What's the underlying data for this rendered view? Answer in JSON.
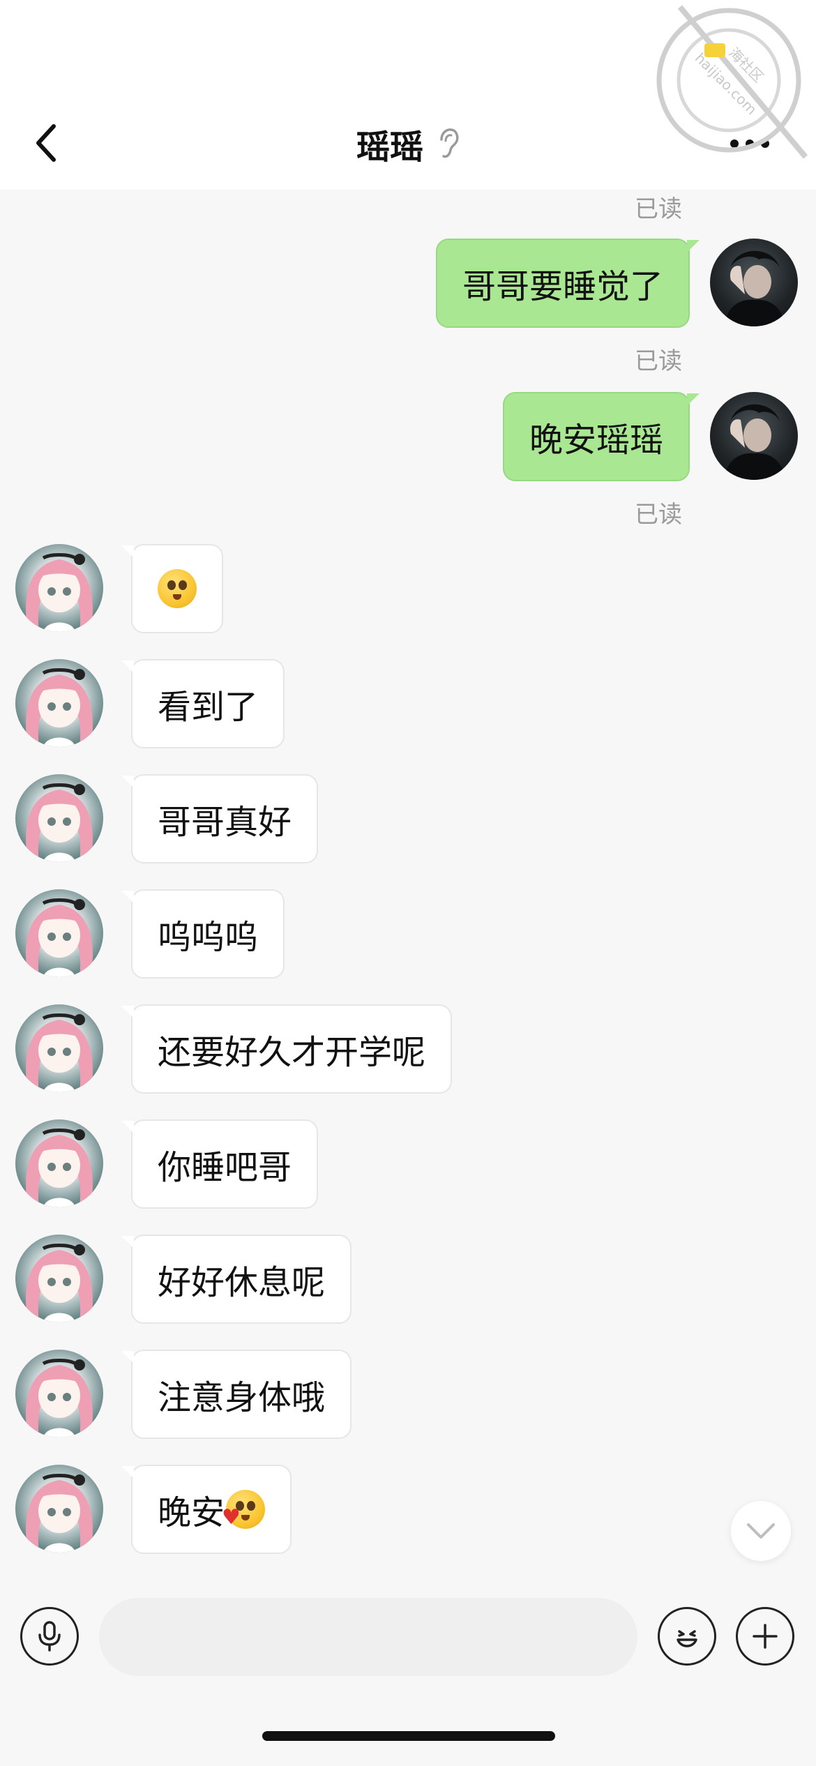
{
  "header": {
    "title": "瑶瑶",
    "back_icon": "chevron-left-icon",
    "ear_icon": "ear-icon",
    "more_icon": "more-dots-icon"
  },
  "watermark": {
    "text": "海社区",
    "url_text": "haijiao.com"
  },
  "status": {
    "read_label": "已读"
  },
  "messages_me": [
    {
      "text": "哥哥要睡觉了",
      "read": "已读"
    },
    {
      "text": "晚安瑶瑶",
      "read": "已读"
    }
  ],
  "messages_her": [
    {
      "text": "",
      "emoji": "blushing-face-emoji"
    },
    {
      "text": "看到了"
    },
    {
      "text": "哥哥真好"
    },
    {
      "text": "呜呜呜"
    },
    {
      "text": "还要好久才开学呢"
    },
    {
      "text": "你睡吧哥"
    },
    {
      "text": "好好休息呢"
    },
    {
      "text": "注意身体哦"
    },
    {
      "text": "晚安",
      "emoji": "hugging-heart-emoji"
    }
  ],
  "input": {
    "value": "",
    "placeholder": ""
  },
  "colors": {
    "my_bubble": "#a9e793",
    "her_bubble": "#ffffff",
    "background": "#f7f7f7"
  }
}
